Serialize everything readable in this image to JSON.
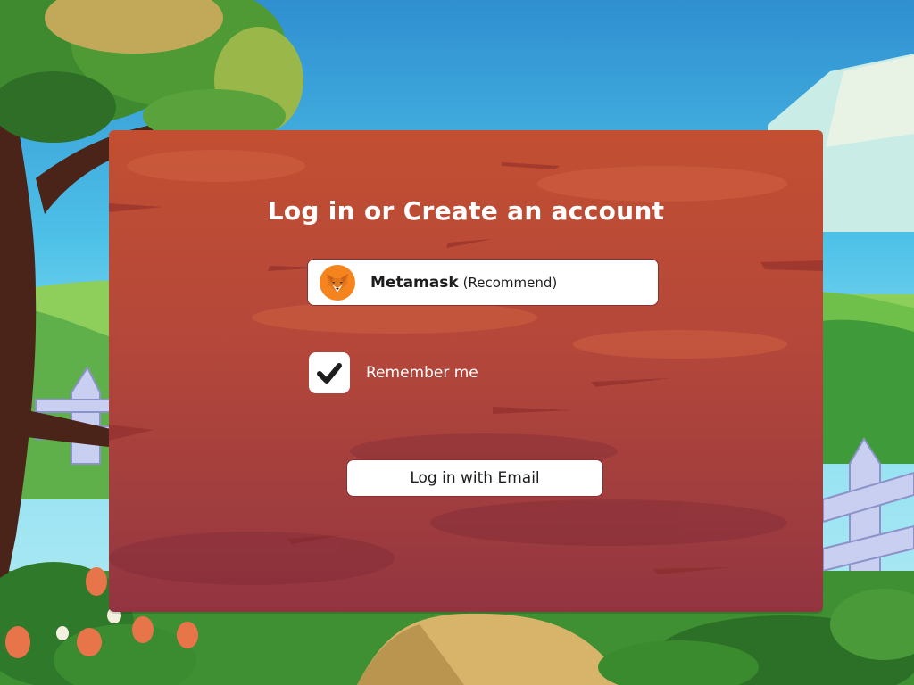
{
  "login_panel": {
    "title": "Log in or Create an account",
    "metamask_button": {
      "name": "Metamask",
      "note": "(Recommend)",
      "icon": "metamask-fox-icon"
    },
    "remember_me": {
      "label": "Remember me",
      "checked": true,
      "icon": "checkmark-icon"
    },
    "email_button": {
      "label": "Log in with Email"
    }
  },
  "colors": {
    "panel": "#b4473a",
    "button_bg": "#ffffff",
    "text_light": "#ffffff",
    "text_dark": "#1d1d1d",
    "metamask_orange": "#f5841f",
    "sky": "#3aa0d8"
  }
}
